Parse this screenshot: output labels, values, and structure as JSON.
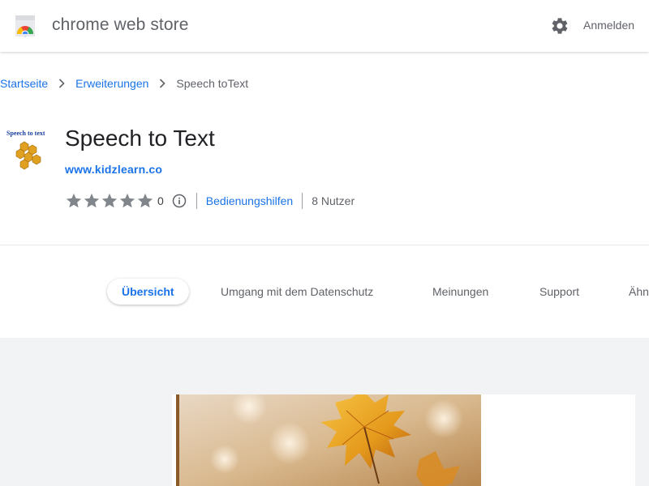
{
  "header": {
    "store_title": "chrome web store",
    "signin_label": "Anmelden",
    "settings_icon": "gear-icon",
    "logo_icon": "chrome-web-store-logo-icon"
  },
  "breadcrumb": {
    "items": [
      "Startseite",
      "Erweiterungen"
    ],
    "current": "Speech toText"
  },
  "extension": {
    "title": "Speech to Text",
    "icon_text": "Speech to text",
    "website": "www.kidzlearn.co",
    "rating": 0,
    "rating_count": "0",
    "category": "Bedienungshilfen",
    "users": "8 Nutzer"
  },
  "tabs": [
    {
      "label": "Übersicht",
      "active": true
    },
    {
      "label": "Umgang mit dem Datenschutz",
      "active": false
    },
    {
      "label": "Meinungen",
      "active": false
    },
    {
      "label": "Support",
      "active": false
    },
    {
      "label": "Ähn",
      "active": false
    }
  ],
  "colors": {
    "accent": "#1a73e8",
    "text_secondary": "#5f6368",
    "star_empty": "#80868b",
    "gallery_bg": "#f1f3f4"
  }
}
